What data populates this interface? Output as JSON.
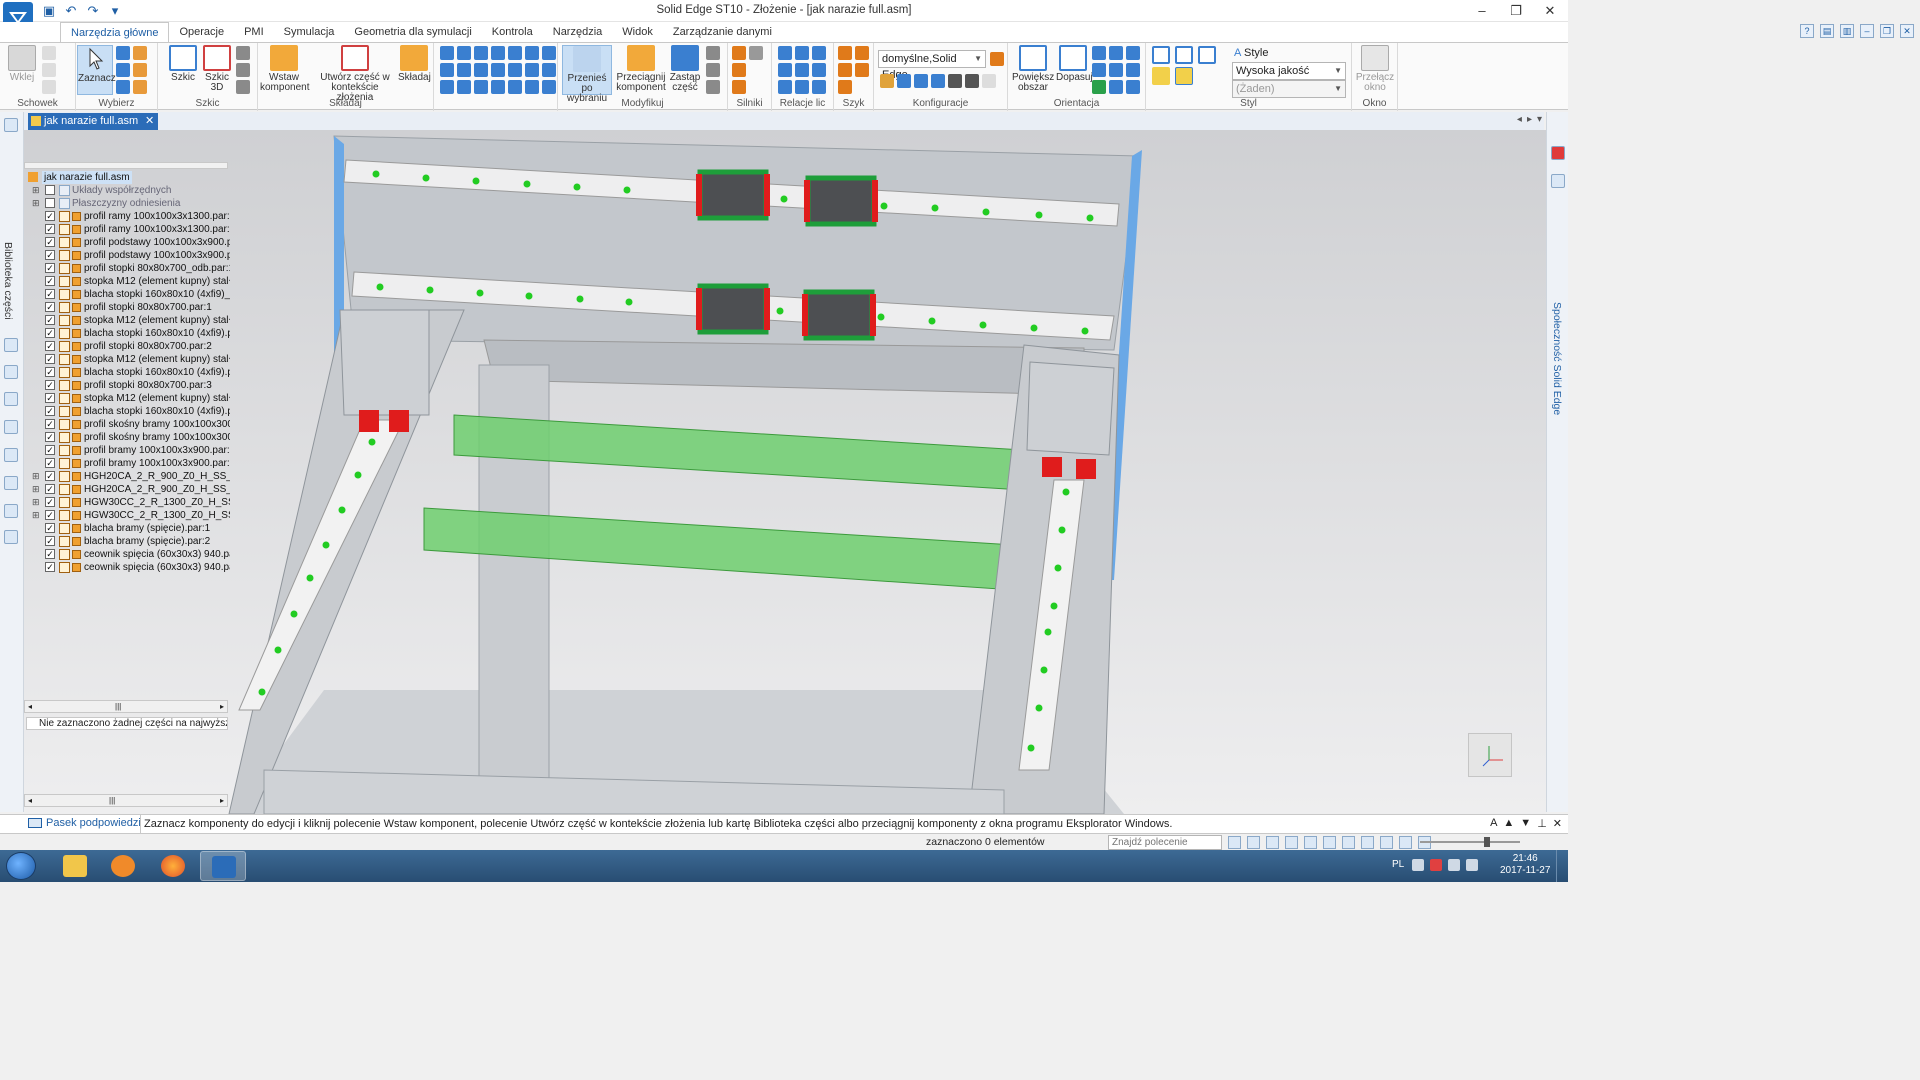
{
  "window": {
    "title": "Solid Edge ST10 - Złożenie - [jak narazie full.asm]",
    "controls": [
      "–",
      "❐",
      "✕"
    ]
  },
  "ribbon_tabs": [
    {
      "label": "Narzędzia główne",
      "active": true
    },
    {
      "label": "Operacje"
    },
    {
      "label": "PMI"
    },
    {
      "label": "Symulacja"
    },
    {
      "label": "Geometria dla symulacji"
    },
    {
      "label": "Kontrola"
    },
    {
      "label": "Narzędzia"
    },
    {
      "label": "Widok"
    },
    {
      "label": "Zarządzanie danymi"
    }
  ],
  "ribbon": {
    "groups": {
      "schowek": "Schowek",
      "wybierz": "Wybierz",
      "szkic": "Szkic",
      "skladaj": "Składaj",
      "modyfikuj": "Modyfikuj",
      "silniki": "Silniki",
      "relacje": "Relacje lic",
      "szyk": "Szyk",
      "konfiguracje": "Konfiguracje",
      "orientacja": "Orientacja",
      "styl": "Styl",
      "okno": "Okno"
    },
    "buttons": {
      "wklej": "Wklej",
      "zaznacz": "Zaznacz",
      "szkic": "Szkic",
      "szkic3d_1": "Szkic",
      "szkic3d_2": "3D",
      "wstaw_1": "Wstaw",
      "wstaw_2": "komponent",
      "utworz_1": "Utwórz część w",
      "utworz_2": "kontekście złożenia",
      "skladaj": "Składaj",
      "przenies_1": "Przenieś po",
      "przenies_2": "wybraniu",
      "przeciagnij_1": "Przeciągnij",
      "przeciagnij_2": "komponent",
      "zastap_1": "Zastąp",
      "zastap_2": "część",
      "powieksz_1": "Powiększ",
      "powieksz_2": "obszar",
      "dopasuj": "Dopasuj",
      "przelacz_1": "Przełącz",
      "przelacz_2": "okno"
    },
    "config_combo": "domyślne,Solid Edge",
    "style_label": "Style",
    "quality_combo": "Wysoka jakość",
    "style_combo": "(Żaden)"
  },
  "doc_tab": "jak narazie full.asm",
  "left_panel_label": "Biblioteka części",
  "right_panel_label": "Społeczność Solid Edge",
  "tree": {
    "root": "jak narazie full.asm",
    "items": [
      {
        "label": "Układy współrzędnych",
        "checked": false,
        "exp": "+",
        "gray": true
      },
      {
        "label": "Płaszczyzny odniesienia",
        "checked": false,
        "exp": "+",
        "gray": true
      },
      {
        "label": "profil ramy 100x100x3x1300.par:1",
        "checked": true
      },
      {
        "label": "profil ramy 100x100x3x1300.par:2",
        "checked": true
      },
      {
        "label": "profil podstawy 100x100x3x900.par:",
        "checked": true
      },
      {
        "label": "profil podstawy 100x100x3x900.par:",
        "checked": true
      },
      {
        "label": "profil stopki 80x80x700_odb.par:1",
        "checked": true
      },
      {
        "label": "stopka M12 (element kupny) stal+tw",
        "checked": true
      },
      {
        "label": "blacha stopki 160x80x10 (4xfi9)_odb",
        "checked": true
      },
      {
        "label": "profil stopki 80x80x700.par:1",
        "checked": true
      },
      {
        "label": "stopka M12 (element kupny) stal+tw",
        "checked": true
      },
      {
        "label": "blacha stopki 160x80x10 (4xfi9).par:",
        "checked": true
      },
      {
        "label": "profil stopki 80x80x700.par:2",
        "checked": true
      },
      {
        "label": "stopka M12 (element kupny) stal+tw",
        "checked": true
      },
      {
        "label": "blacha stopki 160x80x10 (4xfi9).par:",
        "checked": true
      },
      {
        "label": "profil stopki 80x80x700.par:3",
        "checked": true
      },
      {
        "label": "stopka M12 (element kupny) stal+tw",
        "checked": true
      },
      {
        "label": "blacha stopki 160x80x10 (4xfi9).par:",
        "checked": true
      },
      {
        "label": "profil skośny bramy 100x100x300 .pa",
        "checked": true
      },
      {
        "label": "profil skośny bramy 100x100x300 .pa",
        "checked": true
      },
      {
        "label": "profil bramy 100x100x3x900.par:5",
        "checked": true
      },
      {
        "label": "profil bramy 100x100x3x900.par:6",
        "checked": true
      },
      {
        "label": "HGH20CA_2_R_900_Z0_H_SS_FI",
        "checked": true,
        "exp": "+"
      },
      {
        "label": "HGH20CA_2_R_900_Z0_H_SS_FI",
        "checked": true,
        "exp": "+"
      },
      {
        "label": "HGW30CC_2_R_1300_Z0_H_SS_",
        "checked": true,
        "exp": "+"
      },
      {
        "label": "HGW30CC_2_R_1300_Z0_H_SS_",
        "checked": true,
        "exp": "+"
      },
      {
        "label": "blacha bramy (spięcie).par:1",
        "checked": true
      },
      {
        "label": "blacha bramy (spięcie).par:2",
        "checked": true
      },
      {
        "label": "ceownik spięcia (60x30x3) 940.par:",
        "checked": true
      },
      {
        "label": "ceownik spięcia (60x30x3) 940.par:",
        "checked": true
      }
    ],
    "status": "Nie zaznaczono żadnej części na najwyższym po"
  },
  "prompt": {
    "hint_label": "Pasek podpowiedzi",
    "text": "Zaznacz komponenty do edycji i kliknij polecenie Wstaw komponent, polecenie Utwórz część w kontekście złożenia lub kartę Biblioteka części albo przeciągnij komponenty z okna programu Eksplorator Windows."
  },
  "status": {
    "selected": "zaznaczono 0 elementów",
    "search_placeholder": "Znajdź polecenie"
  },
  "taskbar": {
    "lang": "PL",
    "time": "21:46",
    "date": "2017-11-27"
  },
  "colors": {
    "accent": "#2b6cb8",
    "rail_green": "#22cc22",
    "block_red": "#e01c1c",
    "block_green": "#1e9e3a",
    "channel_green": "#6fcf6f",
    "frame_gray": "#c4c8cd",
    "frame_blue": "#5a9be0"
  }
}
